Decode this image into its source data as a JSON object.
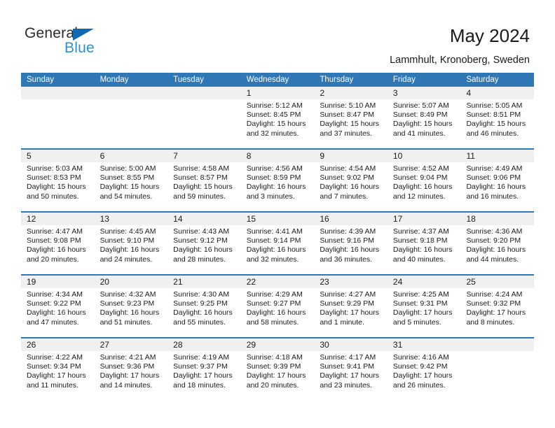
{
  "brand": {
    "name_part1": "General",
    "name_part2": "Blue",
    "triangle_color": "#1168b3",
    "part1_color": "#2b2b2b",
    "part2_color": "#2e8fd4"
  },
  "header": {
    "title": "May 2024",
    "subtitle": "Lammhult, Kronoberg, Sweden"
  },
  "calendar": {
    "header_bg": "#3077b6",
    "datebar_bg": "#f0f0f0",
    "weekdays": [
      "Sunday",
      "Monday",
      "Tuesday",
      "Wednesday",
      "Thursday",
      "Friday",
      "Saturday"
    ],
    "weeks": [
      [
        {
          "day": "",
          "sunrise": "",
          "sunset": "",
          "daylight1": "",
          "daylight2": ""
        },
        {
          "day": "",
          "sunrise": "",
          "sunset": "",
          "daylight1": "",
          "daylight2": ""
        },
        {
          "day": "",
          "sunrise": "",
          "sunset": "",
          "daylight1": "",
          "daylight2": ""
        },
        {
          "day": "1",
          "sunrise": "Sunrise: 5:12 AM",
          "sunset": "Sunset: 8:45 PM",
          "daylight1": "Daylight: 15 hours",
          "daylight2": "and 32 minutes."
        },
        {
          "day": "2",
          "sunrise": "Sunrise: 5:10 AM",
          "sunset": "Sunset: 8:47 PM",
          "daylight1": "Daylight: 15 hours",
          "daylight2": "and 37 minutes."
        },
        {
          "day": "3",
          "sunrise": "Sunrise: 5:07 AM",
          "sunset": "Sunset: 8:49 PM",
          "daylight1": "Daylight: 15 hours",
          "daylight2": "and 41 minutes."
        },
        {
          "day": "4",
          "sunrise": "Sunrise: 5:05 AM",
          "sunset": "Sunset: 8:51 PM",
          "daylight1": "Daylight: 15 hours",
          "daylight2": "and 46 minutes."
        }
      ],
      [
        {
          "day": "5",
          "sunrise": "Sunrise: 5:03 AM",
          "sunset": "Sunset: 8:53 PM",
          "daylight1": "Daylight: 15 hours",
          "daylight2": "and 50 minutes."
        },
        {
          "day": "6",
          "sunrise": "Sunrise: 5:00 AM",
          "sunset": "Sunset: 8:55 PM",
          "daylight1": "Daylight: 15 hours",
          "daylight2": "and 54 minutes."
        },
        {
          "day": "7",
          "sunrise": "Sunrise: 4:58 AM",
          "sunset": "Sunset: 8:57 PM",
          "daylight1": "Daylight: 15 hours",
          "daylight2": "and 59 minutes."
        },
        {
          "day": "8",
          "sunrise": "Sunrise: 4:56 AM",
          "sunset": "Sunset: 8:59 PM",
          "daylight1": "Daylight: 16 hours",
          "daylight2": "and 3 minutes."
        },
        {
          "day": "9",
          "sunrise": "Sunrise: 4:54 AM",
          "sunset": "Sunset: 9:02 PM",
          "daylight1": "Daylight: 16 hours",
          "daylight2": "and 7 minutes."
        },
        {
          "day": "10",
          "sunrise": "Sunrise: 4:52 AM",
          "sunset": "Sunset: 9:04 PM",
          "daylight1": "Daylight: 16 hours",
          "daylight2": "and 12 minutes."
        },
        {
          "day": "11",
          "sunrise": "Sunrise: 4:49 AM",
          "sunset": "Sunset: 9:06 PM",
          "daylight1": "Daylight: 16 hours",
          "daylight2": "and 16 minutes."
        }
      ],
      [
        {
          "day": "12",
          "sunrise": "Sunrise: 4:47 AM",
          "sunset": "Sunset: 9:08 PM",
          "daylight1": "Daylight: 16 hours",
          "daylight2": "and 20 minutes."
        },
        {
          "day": "13",
          "sunrise": "Sunrise: 4:45 AM",
          "sunset": "Sunset: 9:10 PM",
          "daylight1": "Daylight: 16 hours",
          "daylight2": "and 24 minutes."
        },
        {
          "day": "14",
          "sunrise": "Sunrise: 4:43 AM",
          "sunset": "Sunset: 9:12 PM",
          "daylight1": "Daylight: 16 hours",
          "daylight2": "and 28 minutes."
        },
        {
          "day": "15",
          "sunrise": "Sunrise: 4:41 AM",
          "sunset": "Sunset: 9:14 PM",
          "daylight1": "Daylight: 16 hours",
          "daylight2": "and 32 minutes."
        },
        {
          "day": "16",
          "sunrise": "Sunrise: 4:39 AM",
          "sunset": "Sunset: 9:16 PM",
          "daylight1": "Daylight: 16 hours",
          "daylight2": "and 36 minutes."
        },
        {
          "day": "17",
          "sunrise": "Sunrise: 4:37 AM",
          "sunset": "Sunset: 9:18 PM",
          "daylight1": "Daylight: 16 hours",
          "daylight2": "and 40 minutes."
        },
        {
          "day": "18",
          "sunrise": "Sunrise: 4:36 AM",
          "sunset": "Sunset: 9:20 PM",
          "daylight1": "Daylight: 16 hours",
          "daylight2": "and 44 minutes."
        }
      ],
      [
        {
          "day": "19",
          "sunrise": "Sunrise: 4:34 AM",
          "sunset": "Sunset: 9:22 PM",
          "daylight1": "Daylight: 16 hours",
          "daylight2": "and 47 minutes."
        },
        {
          "day": "20",
          "sunrise": "Sunrise: 4:32 AM",
          "sunset": "Sunset: 9:23 PM",
          "daylight1": "Daylight: 16 hours",
          "daylight2": "and 51 minutes."
        },
        {
          "day": "21",
          "sunrise": "Sunrise: 4:30 AM",
          "sunset": "Sunset: 9:25 PM",
          "daylight1": "Daylight: 16 hours",
          "daylight2": "and 55 minutes."
        },
        {
          "day": "22",
          "sunrise": "Sunrise: 4:29 AM",
          "sunset": "Sunset: 9:27 PM",
          "daylight1": "Daylight: 16 hours",
          "daylight2": "and 58 minutes."
        },
        {
          "day": "23",
          "sunrise": "Sunrise: 4:27 AM",
          "sunset": "Sunset: 9:29 PM",
          "daylight1": "Daylight: 17 hours",
          "daylight2": "and 1 minute."
        },
        {
          "day": "24",
          "sunrise": "Sunrise: 4:25 AM",
          "sunset": "Sunset: 9:31 PM",
          "daylight1": "Daylight: 17 hours",
          "daylight2": "and 5 minutes."
        },
        {
          "day": "25",
          "sunrise": "Sunrise: 4:24 AM",
          "sunset": "Sunset: 9:32 PM",
          "daylight1": "Daylight: 17 hours",
          "daylight2": "and 8 minutes."
        }
      ],
      [
        {
          "day": "26",
          "sunrise": "Sunrise: 4:22 AM",
          "sunset": "Sunset: 9:34 PM",
          "daylight1": "Daylight: 17 hours",
          "daylight2": "and 11 minutes."
        },
        {
          "day": "27",
          "sunrise": "Sunrise: 4:21 AM",
          "sunset": "Sunset: 9:36 PM",
          "daylight1": "Daylight: 17 hours",
          "daylight2": "and 14 minutes."
        },
        {
          "day": "28",
          "sunrise": "Sunrise: 4:19 AM",
          "sunset": "Sunset: 9:37 PM",
          "daylight1": "Daylight: 17 hours",
          "daylight2": "and 18 minutes."
        },
        {
          "day": "29",
          "sunrise": "Sunrise: 4:18 AM",
          "sunset": "Sunset: 9:39 PM",
          "daylight1": "Daylight: 17 hours",
          "daylight2": "and 20 minutes."
        },
        {
          "day": "30",
          "sunrise": "Sunrise: 4:17 AM",
          "sunset": "Sunset: 9:41 PM",
          "daylight1": "Daylight: 17 hours",
          "daylight2": "and 23 minutes."
        },
        {
          "day": "31",
          "sunrise": "Sunrise: 4:16 AM",
          "sunset": "Sunset: 9:42 PM",
          "daylight1": "Daylight: 17 hours",
          "daylight2": "and 26 minutes."
        },
        {
          "day": "",
          "sunrise": "",
          "sunset": "",
          "daylight1": "",
          "daylight2": ""
        }
      ]
    ]
  }
}
